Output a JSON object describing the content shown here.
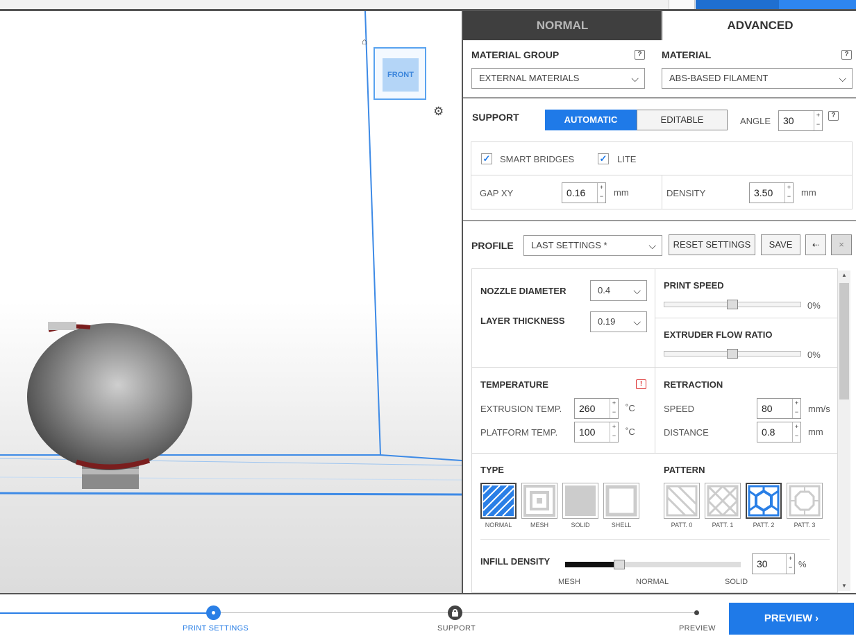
{
  "viewport": {
    "cube_face_label": "FRONT"
  },
  "tabs": {
    "normal": "NORMAL",
    "advanced": "ADVANCED"
  },
  "material": {
    "group_label": "MATERIAL GROUP",
    "group_value": "EXTERNAL MATERIALS",
    "material_label": "MATERIAL",
    "material_value": "ABS-BASED FILAMENT",
    "help": "?"
  },
  "support": {
    "label": "SUPPORT",
    "automatic": "AUTOMATIC",
    "editable": "EDITABLE",
    "angle_label": "ANGLE",
    "angle_value": "30",
    "smart_bridges": "SMART BRIDGES",
    "lite": "LITE",
    "gap_xy_label": "GAP XY",
    "gap_xy_value": "0.16",
    "gap_unit": "mm",
    "density_label": "DENSITY",
    "density_value": "3.50",
    "density_unit": "mm"
  },
  "profile": {
    "label": "PROFILE",
    "value": "LAST SETTINGS *",
    "reset": "RESET SETTINGS",
    "save": "SAVE"
  },
  "settings": {
    "nozzle_label": "NOZZLE DIAMETER",
    "nozzle_value": "0.4",
    "layer_label": "LAYER THICKNESS",
    "layer_value": "0.19",
    "print_speed_label": "PRINT SPEED",
    "print_speed_value": "0%",
    "flow_label": "EXTRUDER FLOW RATIO",
    "flow_value": "0%",
    "temperature_label": "TEMPERATURE",
    "extrusion_label": "EXTRUSION TEMP.",
    "extrusion_value": "260",
    "platform_label": "PLATFORM TEMP.",
    "platform_value": "100",
    "temp_unit": "˚C",
    "retraction_label": "RETRACTION",
    "speed_label": "SPEED",
    "speed_value": "80",
    "speed_unit": "mm/s",
    "distance_label": "DISTANCE",
    "distance_value": "0.8",
    "distance_unit": "mm",
    "type_label": "TYPE",
    "types": [
      "NORMAL",
      "MESH",
      "SOLID",
      "SHELL"
    ],
    "pattern_label": "PATTERN",
    "patterns": [
      "PATT. 0",
      "PATT. 1",
      "PATT. 2",
      "PATT. 3"
    ],
    "infill_label": "INFILL DENSITY",
    "infill_value": "30",
    "infill_unit": "%",
    "infill_marks": [
      "MESH",
      "NORMAL",
      "SOLID"
    ]
  },
  "steps": {
    "print_settings": "PRINT SETTINGS",
    "support": "SUPPORT",
    "preview": "PREVIEW",
    "preview_button": "PREVIEW"
  },
  "colors": {
    "accent": "#1f7ae8",
    "warning": "#d33"
  }
}
